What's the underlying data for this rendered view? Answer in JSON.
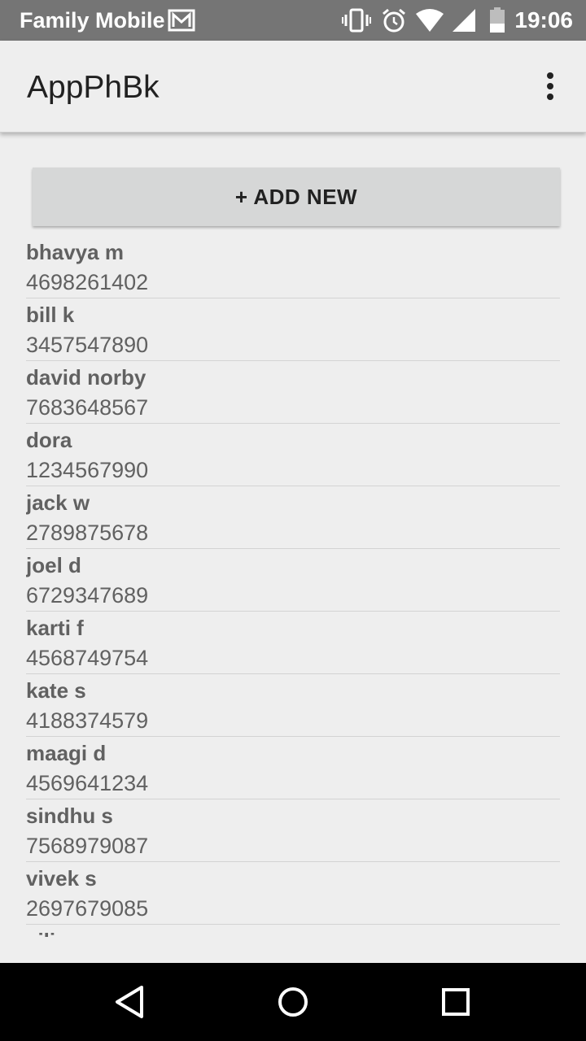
{
  "status_bar": {
    "carrier": "Family Mobile",
    "time": "19:06",
    "icons": [
      "mail-icon",
      "vibrate-icon",
      "alarm-icon",
      "wifi-icon",
      "signal-icon",
      "battery-icon"
    ]
  },
  "app_bar": {
    "title": "AppPhBk",
    "menu_icon": "more-vert-icon"
  },
  "add_button": {
    "label": "+ ADD NEW"
  },
  "contacts": [
    {
      "name": "bhavya m",
      "phone": "4698261402"
    },
    {
      "name": "bill k",
      "phone": "3457547890"
    },
    {
      "name": "david norby",
      "phone": "7683648567"
    },
    {
      "name": "dora",
      "phone": "1234567990"
    },
    {
      "name": "jack w",
      "phone": "2789875678"
    },
    {
      "name": "joel d",
      "phone": "6729347689"
    },
    {
      "name": "karti f",
      "phone": "4568749754"
    },
    {
      "name": "kate s",
      "phone": "4188374579"
    },
    {
      "name": "maagi d",
      "phone": "4569641234"
    },
    {
      "name": "sindhu s",
      "phone": "7568979087"
    },
    {
      "name": "vivek s",
      "phone": "2697679085"
    },
    {
      "name": "vili",
      "phone": ""
    }
  ],
  "nav_bar": {
    "icons": [
      "back-icon",
      "home-icon",
      "recents-icon"
    ]
  },
  "colors": {
    "status_bar": "#757575",
    "background": "#eeeeee",
    "button": "#d6d7d7",
    "contact_text": "#616161",
    "nav_bar": "#000000"
  }
}
